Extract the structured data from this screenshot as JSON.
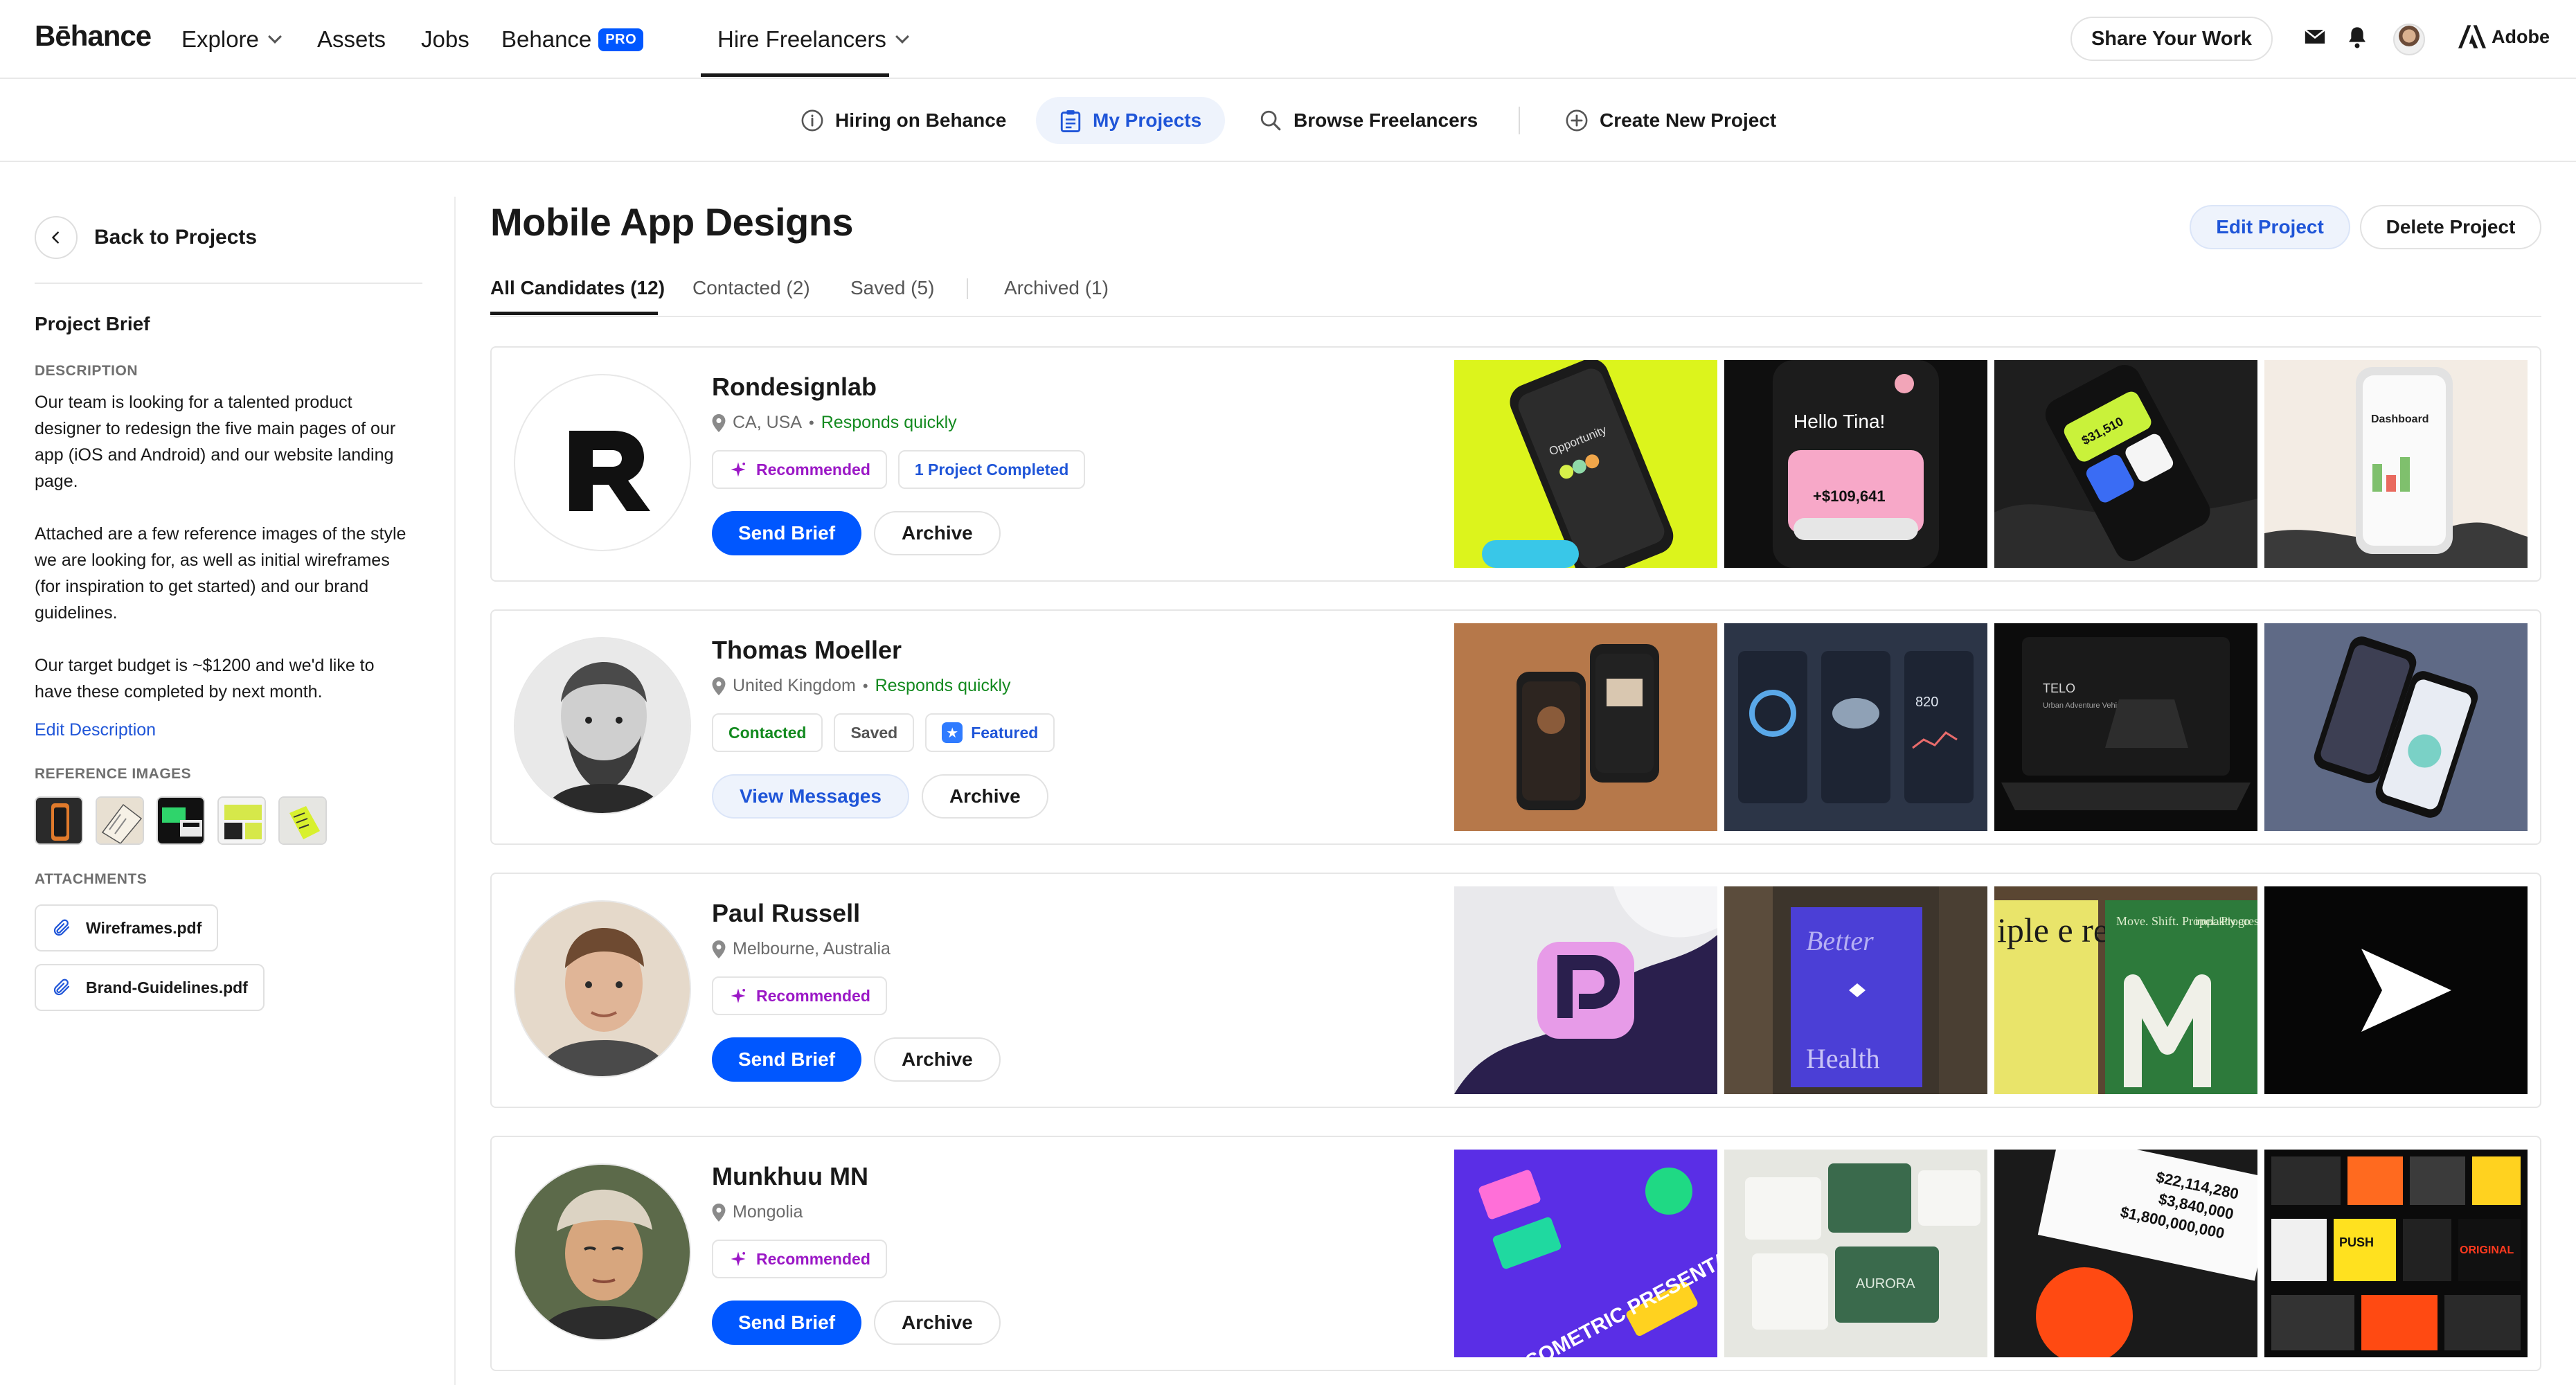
{
  "topnav": {
    "logo": "Bēhance",
    "explore": "Explore",
    "assets": "Assets",
    "jobs": "Jobs",
    "behance": "Behance",
    "pro_badge": "PRO",
    "hire": "Hire Freelancers",
    "share": "Share Your Work",
    "adobe": "Adobe"
  },
  "subnav": {
    "hiring": "Hiring on Behance",
    "my_projects": "My Projects",
    "browse": "Browse Freelancers",
    "create": "Create New Project"
  },
  "sidebar": {
    "back": "Back to Projects",
    "brief_title": "Project Brief",
    "description_label": "DESCRIPTION",
    "description": [
      "Our team is looking for a talented product designer to redesign the five main pages of our app (iOS and Android) and our website landing page.",
      "Attached are a few reference images of the style we are looking for, as well as initial wireframes (for inspiration to get started) and our brand guidelines.",
      "Our target budget is ~$1200 and we'd like to have these completed by next month."
    ],
    "edit_description": "Edit Description",
    "reference_label": "REFERENCE IMAGES",
    "attachments_label": "ATTACHMENTS",
    "attachments": [
      "Wireframes.pdf",
      "Brand-Guidelines.pdf"
    ]
  },
  "main": {
    "title": "Mobile App Designs",
    "edit_project": "Edit Project",
    "delete_project": "Delete Project",
    "tabs": [
      "All Candidates (12)",
      "Contacted (2)",
      "Saved (5)",
      "Archived (1)"
    ]
  },
  "candidates": [
    {
      "name": "Rondesignlab",
      "location": "CA, USA",
      "responds": "Responds quickly",
      "chips": [
        "Recommended",
        "1 Project Completed"
      ],
      "primary": "Send Brief",
      "secondary": "Archive",
      "thumbs": [
        "Opportunity",
        "Hello Tina!",
        "+$109,641",
        "$31,510",
        "Dashboard"
      ]
    },
    {
      "name": "Thomas Moeller",
      "location": "United Kingdom",
      "responds": "Responds quickly",
      "chips": [
        "Contacted",
        "Saved",
        "Featured"
      ],
      "primary": "View Messages",
      "secondary": "Archive",
      "thumbs": [
        "820",
        "TELO",
        "Urban Adventure Vehicles"
      ]
    },
    {
      "name": "Paul Russell",
      "location": "Melbourne, Australia",
      "responds": "",
      "chips": [
        "Recommended"
      ],
      "primary": "Send Brief",
      "secondary": "Archive",
      "thumbs": [
        "Better",
        "Health",
        "iple e re.",
        "Move. Shift. Propel. Progress.",
        "impaktly.co"
      ]
    },
    {
      "name": "Munkhuu MN",
      "location": "Mongolia",
      "responds": "",
      "chips": [
        "Recommended"
      ],
      "primary": "Send Brief",
      "secondary": "Archive",
      "thumbs": [
        "ISOMETRIC PRESENTATION",
        "AURORA",
        "$22,114,280",
        "$3,840,000",
        "$1,800,000,000",
        "PUSH",
        "ORIGINAL"
      ]
    }
  ],
  "colors": {
    "accent": "#0057ff",
    "link": "#1f55d8",
    "recommended": "#9b18c6",
    "success": "#138a1f"
  }
}
